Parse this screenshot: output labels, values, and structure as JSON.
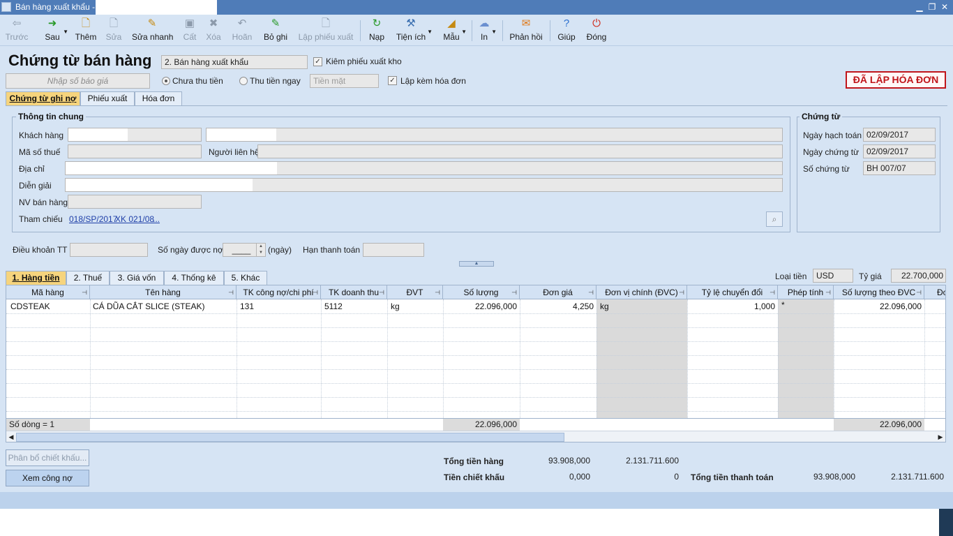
{
  "window": {
    "title": "Bán hàng xuất khẩu -"
  },
  "toolbar": {
    "prev": "Trước",
    "next": "Sau",
    "add": "Thêm",
    "edit": "Sửa",
    "quick_edit": "Sửa nhanh",
    "save": "Cất",
    "delete": "Xóa",
    "undo": "Hoãn",
    "unpost": "Bỏ ghi",
    "create_issue": "Lập phiếu xuất",
    "reload": "Nạp",
    "utilities": "Tiện ích",
    "template": "Mẫu",
    "print": "In",
    "feedback": "Phản hồi",
    "help": "Giúp",
    "close": "Đóng"
  },
  "header": {
    "title": "Chứng từ bán hàng",
    "sale_type": "2. Bán hàng xuất khẩu",
    "check_issue": "Kiêm phiếu xuất kho",
    "quote_placeholder": "Nhập số báo giá",
    "unpaid": "Chưa thu tiền",
    "paid_now": "Thu tiền ngay",
    "cash": "Tiền mặt",
    "with_invoice": "Lập kèm hóa đơn",
    "stamp": "ĐÃ LẬP HÓA ĐƠN"
  },
  "tabs": {
    "debt_voucher": "Chứng từ ghi nợ",
    "issue_slip": "Phiếu xuất",
    "invoice": "Hóa đơn"
  },
  "general": {
    "title": "Thông tin chung",
    "customer": "Khách hàng",
    "tax_code": "Mã số thuế",
    "contact": "Người liên hệ",
    "address": "Địa chỉ",
    "description": "Diễn giải",
    "salesperson": "NV bán hàng",
    "reference": "Tham chiếu",
    "ref1": "018/SP/2017",
    "ref2": "XK 021/08",
    "ref_more": "..."
  },
  "voucher": {
    "title": "Chứng từ",
    "posting_date_label": "Ngày hạch toán",
    "posting_date": "02/09/2017",
    "voucher_date_label": "Ngày chứng từ",
    "voucher_date": "02/09/2017",
    "voucher_no_label": "Số chứng từ",
    "voucher_no": "BH 007/07"
  },
  "terms": {
    "payment_terms": "Điều khoản TT",
    "credit_days": "Số ngày được nợ",
    "credit_days_value": "____",
    "days_unit": "(ngày)",
    "due_date": "Hạn thanh toán"
  },
  "detail_tabs": {
    "goods": "1. Hàng tiền",
    "tax": "2. Thuế",
    "cost": "3. Giá vốn",
    "stats": "4. Thống kê",
    "other": "5. Khác"
  },
  "currency": {
    "label": "Loại tiền",
    "value": "USD",
    "rate_label": "Tỷ giá",
    "rate": "22.700,000"
  },
  "grid": {
    "columns": [
      "Mã hàng",
      "Tên hàng",
      "TK công nợ/chi phí",
      "TK doanh thu",
      "ĐVT",
      "Số lượng",
      "Đơn giá",
      "Đơn vị chính (ĐVC)",
      "Tỷ lệ chuyển đổi",
      "Phép tính",
      "Số lượng theo ĐVC",
      "Đơn"
    ],
    "rows": [
      {
        "code": "CDSTEAK",
        "name": "CÁ DŨA CẮT SLICE (STEAK)",
        "debit_acc": "131",
        "revenue_acc": "5112",
        "unit": "kg",
        "qty": "22.096,000",
        "price": "4,250",
        "main_unit": "kg",
        "ratio": "1,000",
        "op": "*",
        "qty_main": "22.096,000"
      }
    ],
    "footer_rows": "Số dòng = 1",
    "footer_qty": "22.096,000",
    "footer_qty_main": "22.096,000"
  },
  "bottom": {
    "allocate_discount": "Phân bổ chiết khấu...",
    "view_debt": "Xem công nợ",
    "total_goods_label": "Tổng tiền hàng",
    "total_goods": "93.908,000",
    "total_goods_vnd": "2.131.711.600",
    "discount_label": "Tiền chiết khấu",
    "discount": "0,000",
    "discount_vnd": "0",
    "total_pay_label": "Tổng tiền thanh toán",
    "total_pay": "93.908,000",
    "total_pay_vnd": "2.131.711.600"
  },
  "colors": {
    "background": "#d6e4f4",
    "titlebar": "#4f7cb8",
    "stamp": "#c0151b",
    "active_tab": "#f6d47d"
  }
}
